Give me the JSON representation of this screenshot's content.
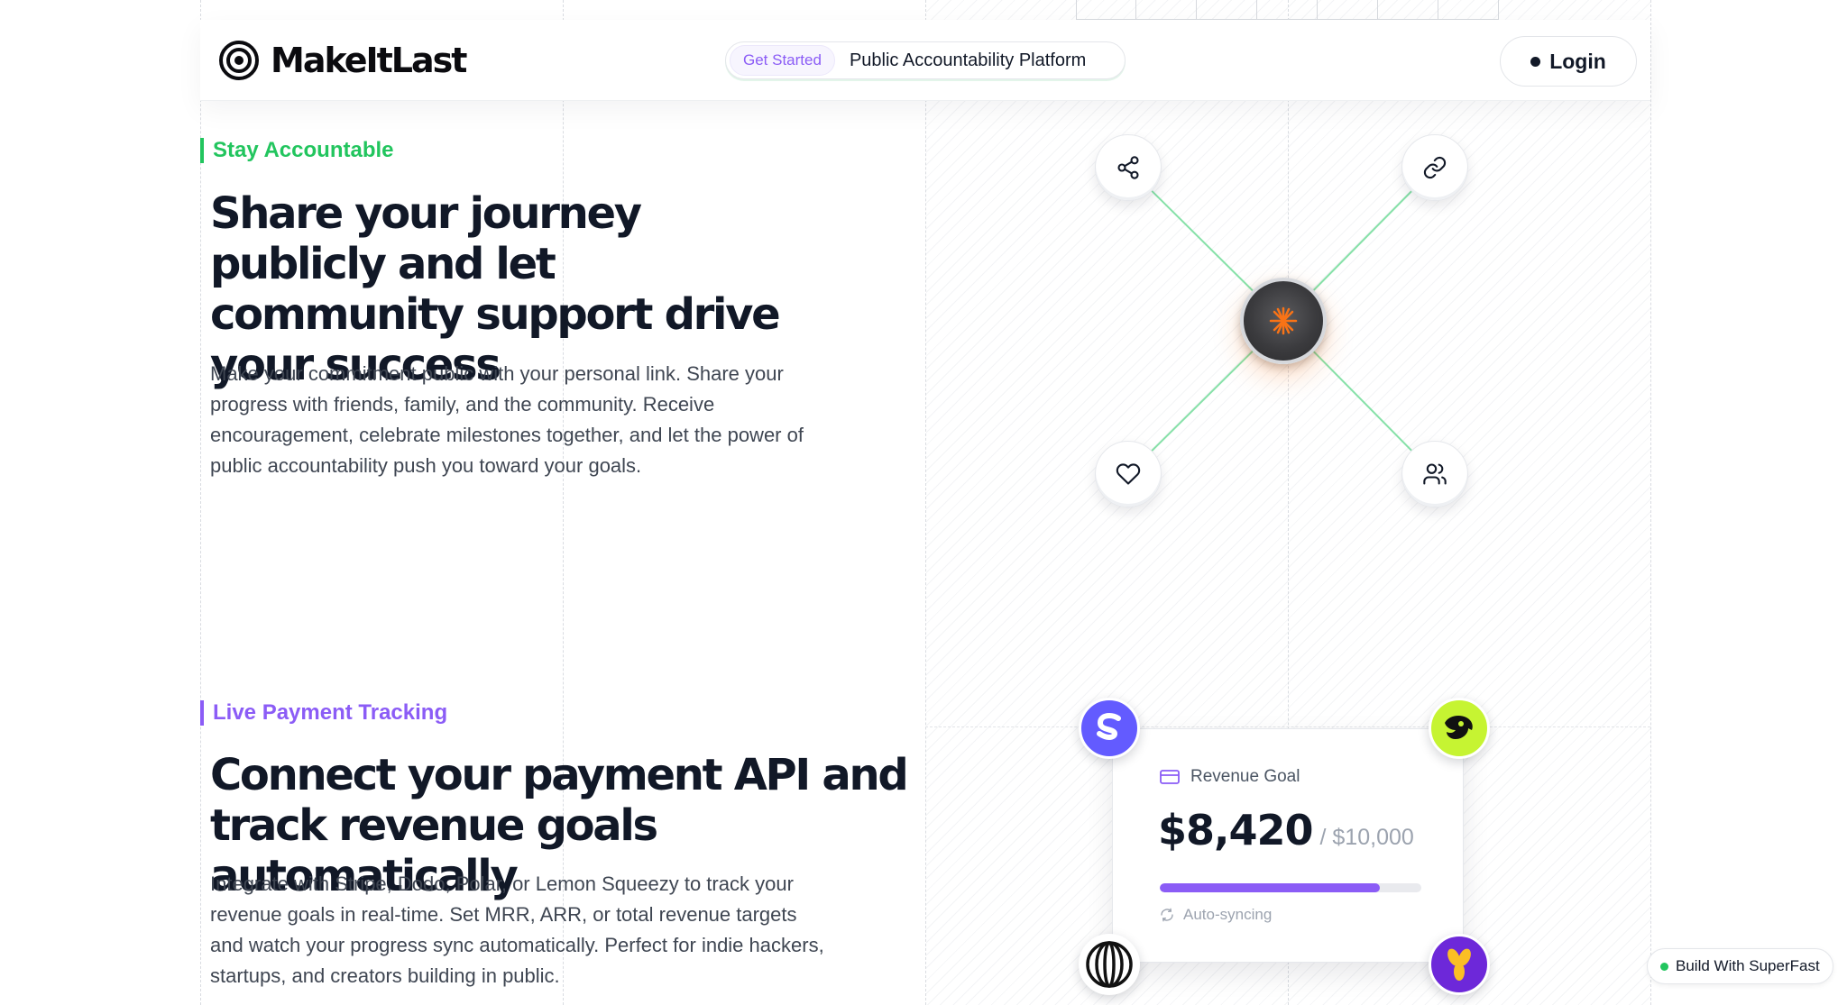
{
  "header": {
    "brand": "MakeItLast",
    "pill_badge": "Get Started",
    "pill_text": "Public Accountability Platform",
    "login_label": "Login"
  },
  "section_accountable": {
    "eyebrow": "Stay Accountable",
    "headline": "Share your journey publicly and let community support drive your success",
    "body": "Make your commitment public with your personal link. Share your progress with friends, family, and the community. Receive encouragement, celebrate milestones together, and let the power of public accountability push you toward your goals.",
    "nodes": [
      "share-icon",
      "link-icon",
      "heart-icon",
      "users-icon"
    ],
    "hub_icon": "spark-icon"
  },
  "section_payments": {
    "eyebrow": "Live Payment Tracking",
    "headline": "Connect your payment API and track revenue goals automatically",
    "body": "Integrate with Stripe, Dodo, Polar, or Lemon Squeezy to track your revenue goals in real-time. Set MRR, ARR, or total revenue targets and watch your progress sync automatically. Perfect for indie hackers, startups, and creators building in public.",
    "card": {
      "title": "Revenue Goal",
      "current": "$8,420",
      "target": "/ $10,000",
      "progress": 0.842,
      "status": "Auto-syncing"
    },
    "providers": [
      "stripe-logo",
      "dodo-logo",
      "polar-logo",
      "lemon-squeezy-logo"
    ]
  },
  "badge": {
    "label": "Build With SuperFast"
  },
  "colors": {
    "accent_green": "#22c55e",
    "accent_purple": "#8b5cf6",
    "hub_orange": "#f97316",
    "stripe": "#635bff",
    "dodo": "#c6f432",
    "lemon": "#7c3aed"
  }
}
